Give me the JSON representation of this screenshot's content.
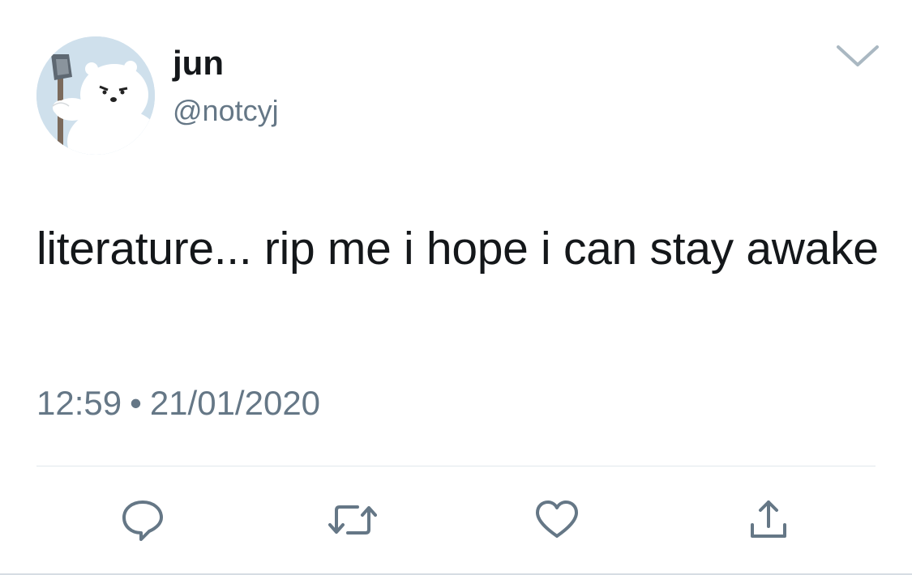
{
  "tweet": {
    "display_name": "jun",
    "handle": "@notcyj",
    "text": "literature... rip me i hope i can stay awake",
    "time": "12:59",
    "separator": "•",
    "date": "21/01/2020"
  },
  "icons": {
    "avatar": "polar-bear-avatar",
    "menu": "chevron-down-icon",
    "reply": "reply-icon",
    "retweet": "retweet-icon",
    "like": "heart-icon",
    "share": "share-icon"
  },
  "colors": {
    "text_primary": "#14171a",
    "text_secondary": "#657786",
    "icon_gray": "#657786",
    "divider": "#e1e8ed"
  }
}
